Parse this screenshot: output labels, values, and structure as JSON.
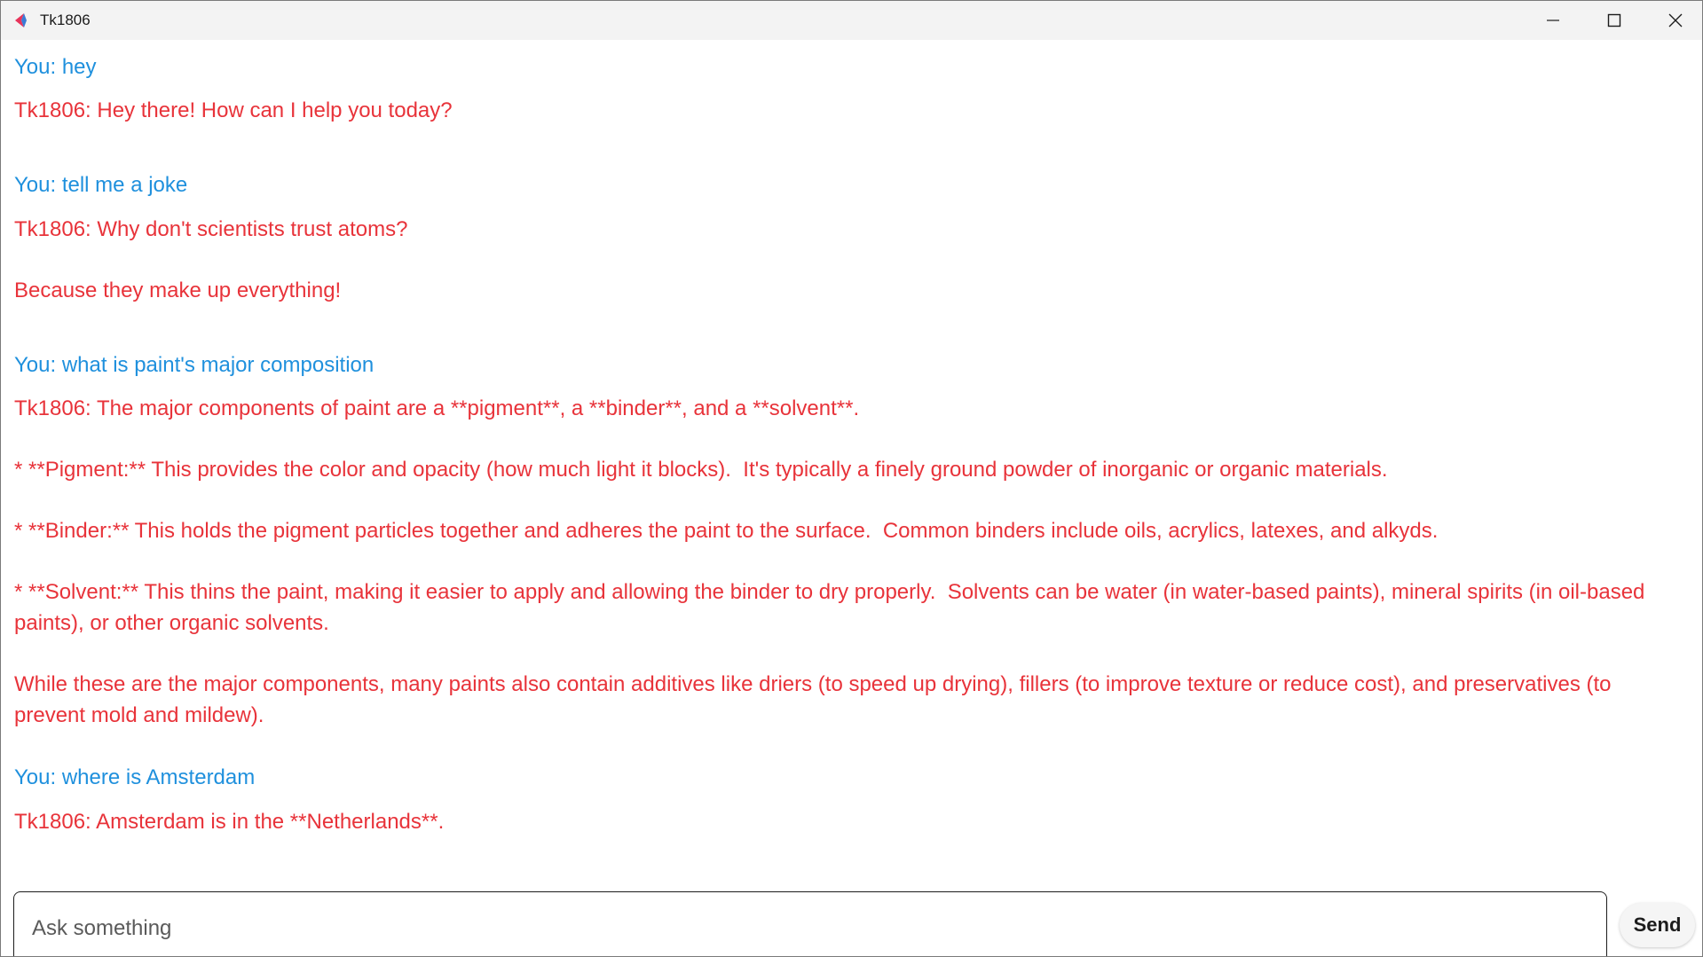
{
  "window": {
    "title": "Tk1806",
    "icon": "app-logo-icon",
    "controls": [
      "minimize-icon",
      "maximize-icon",
      "close-icon"
    ]
  },
  "colors": {
    "user_text": "#1f90dd",
    "bot_text": "#e8333a",
    "titlebar": "#f3f3f3"
  },
  "messages": [
    {
      "role": "user",
      "text": "You: hey"
    },
    {
      "role": "bot",
      "text": "Tk1806: Hey there! How can I help you today?"
    },
    {
      "role": "user",
      "text": "You: tell me a joke"
    },
    {
      "role": "bot",
      "text": "Tk1806: Why don't scientists trust atoms?"
    },
    {
      "role": "bot",
      "text": "Because they make up everything!"
    },
    {
      "role": "user",
      "text": "You: what is paint's major composition"
    },
    {
      "role": "bot",
      "text": "Tk1806: The major components of paint are a **pigment**, a **binder**, and a **solvent**."
    },
    {
      "role": "bot",
      "text": "* **Pigment:** This provides the color and opacity (how much light it blocks).  It's typically a finely ground powder of inorganic or organic materials."
    },
    {
      "role": "bot",
      "text": "* **Binder:** This holds the pigment particles together and adheres the paint to the surface.  Common binders include oils, acrylics, latexes, and alkyds."
    },
    {
      "role": "bot",
      "text": "* **Solvent:** This thins the paint, making it easier to apply and allowing the binder to dry properly.  Solvents can be water (in water-based paints), mineral spirits (in oil-based paints), or other organic solvents."
    },
    {
      "role": "bot",
      "text": "While these are the major components, many paints also contain additives like driers (to speed up drying), fillers (to improve texture or reduce cost), and preservatives (to prevent mold and mildew)."
    },
    {
      "role": "user",
      "text": "You: where is Amsterdam"
    },
    {
      "role": "bot",
      "text": "Tk1806: Amsterdam is in the **Netherlands**."
    }
  ],
  "input": {
    "placeholder": "Ask something",
    "value": ""
  },
  "send_label": "Send"
}
